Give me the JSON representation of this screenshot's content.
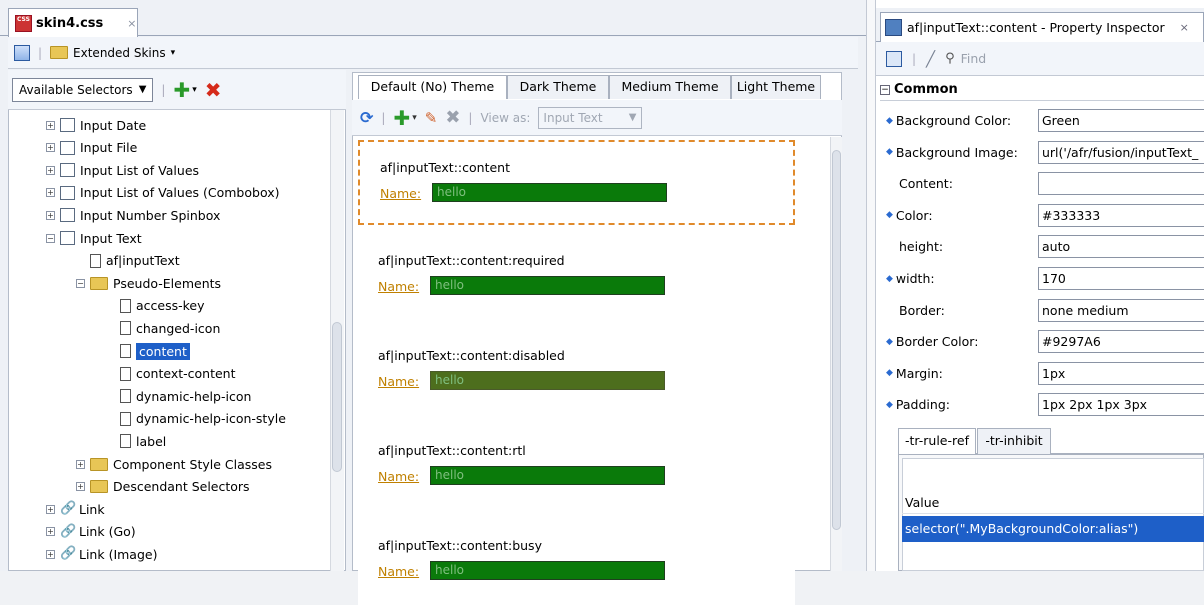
{
  "editor": {
    "tab_title": "skin4.css",
    "tab_close": "×",
    "file_icon_text": "CSS",
    "breadcrumb_label": "Extended Skins",
    "help_glyph": "?"
  },
  "selectors": {
    "combo_label": "Available Selectors",
    "tree": [
      {
        "label": "Input Date",
        "icon": "input-date-icon",
        "expander": "+",
        "indent": 0,
        "selected": false
      },
      {
        "label": "Input File",
        "icon": "input-file-icon",
        "expander": "+",
        "indent": 0,
        "selected": false
      },
      {
        "label": "Input List of Values",
        "icon": "list-of-values-icon",
        "expander": "+",
        "indent": 0,
        "selected": false
      },
      {
        "label": "Input List of Values (Combobox)",
        "icon": "combobox-icon",
        "expander": "+",
        "indent": 0,
        "selected": false
      },
      {
        "label": "Input Number Spinbox",
        "icon": "spinbox-icon",
        "expander": "+",
        "indent": 0,
        "selected": false
      },
      {
        "label": "Input Text",
        "icon": "text-cursor-icon",
        "expander": "−",
        "indent": 0,
        "selected": false
      },
      {
        "label": "af|inputText",
        "icon": "document-icon",
        "expander": "",
        "indent": 1,
        "selected": false
      },
      {
        "label": "Pseudo-Elements",
        "icon": "folder-open-icon",
        "expander": "−",
        "indent": 1,
        "selected": false
      },
      {
        "label": "access-key",
        "icon": "document-icon",
        "expander": "",
        "indent": 2,
        "selected": false
      },
      {
        "label": "changed-icon",
        "icon": "document-icon",
        "expander": "",
        "indent": 2,
        "selected": false
      },
      {
        "label": "content",
        "icon": "document-icon",
        "expander": "",
        "indent": 2,
        "selected": true
      },
      {
        "label": "context-content",
        "icon": "document-icon",
        "expander": "",
        "indent": 2,
        "selected": false
      },
      {
        "label": "dynamic-help-icon",
        "icon": "document-icon",
        "expander": "",
        "indent": 2,
        "selected": false
      },
      {
        "label": "dynamic-help-icon-style",
        "icon": "document-icon",
        "expander": "",
        "indent": 2,
        "selected": false
      },
      {
        "label": "label",
        "icon": "document-icon",
        "expander": "",
        "indent": 2,
        "selected": false
      },
      {
        "label": "Component Style Classes",
        "icon": "folder-icon",
        "expander": "+",
        "indent": 1,
        "selected": false
      },
      {
        "label": "Descendant Selectors",
        "icon": "folder-icon",
        "expander": "+",
        "indent": 1,
        "selected": false
      },
      {
        "label": "Link",
        "icon": "link-icon",
        "expander": "+",
        "indent": 0,
        "selected": false
      },
      {
        "label": "Link (Go)",
        "icon": "link-icon",
        "expander": "+",
        "indent": 0,
        "selected": false
      },
      {
        "label": "Link (Image)",
        "icon": "link-icon",
        "expander": "+",
        "indent": 0,
        "selected": false
      }
    ]
  },
  "preview": {
    "themes": [
      "Default (No) Theme",
      "Dark Theme",
      "Medium Theme",
      "Light Theme"
    ],
    "view_as_label": "View as:",
    "view_as_value": "Input Text",
    "rules": [
      {
        "selector": "af|inputText::content",
        "name_label": "Name:",
        "value": "hello",
        "disabled": false,
        "focused": true
      },
      {
        "selector": "af|inputText::content:required",
        "name_label": "Name:",
        "value": "hello",
        "disabled": false,
        "focused": false
      },
      {
        "selector": "af|inputText::content:disabled",
        "name_label": "Name:",
        "value": "hello",
        "disabled": true,
        "focused": false
      },
      {
        "selector": "af|inputText::content:rtl",
        "name_label": "Name:",
        "value": "hello",
        "disabled": false,
        "focused": false
      },
      {
        "selector": "af|inputText::content:busy",
        "name_label": "Name:",
        "value": "hello",
        "disabled": false,
        "focused": false
      }
    ]
  },
  "inspector": {
    "title": "af|inputText::content - Property Inspector",
    "close": "×",
    "find_placeholder": "Find",
    "section": "Common",
    "properties": [
      {
        "label": "Background Color:",
        "value": "Green",
        "marked": true
      },
      {
        "label": "Background Image:",
        "value": "url('/afr/fusion/inputText_",
        "marked": true
      },
      {
        "label": "Content:",
        "value": "",
        "marked": false
      },
      {
        "label": "Color:",
        "value": "#333333",
        "marked": true
      },
      {
        "label": "height:",
        "value": "auto",
        "marked": false
      },
      {
        "label": "width:",
        "value": "170",
        "marked": true
      },
      {
        "label": "Border:",
        "value": "none medium",
        "marked": false
      },
      {
        "label": "Border Color:",
        "value": "#9297A6",
        "marked": true
      },
      {
        "label": "Margin:",
        "value": "1px",
        "marked": true
      },
      {
        "label": "Padding:",
        "value": "1px 2px 1px 3px",
        "marked": true
      }
    ],
    "subtabs": [
      "-tr-rule-ref",
      "-tr-inhibit"
    ],
    "value_header": "Value",
    "value_selected": "selector(\".MyBackgroundColor:alias\")"
  },
  "colors": {
    "selection": "#1e5fc8",
    "input_green": "#0a7a0a",
    "input_disabled": "#4d6e1d",
    "focus_border": "#e08a2b"
  }
}
